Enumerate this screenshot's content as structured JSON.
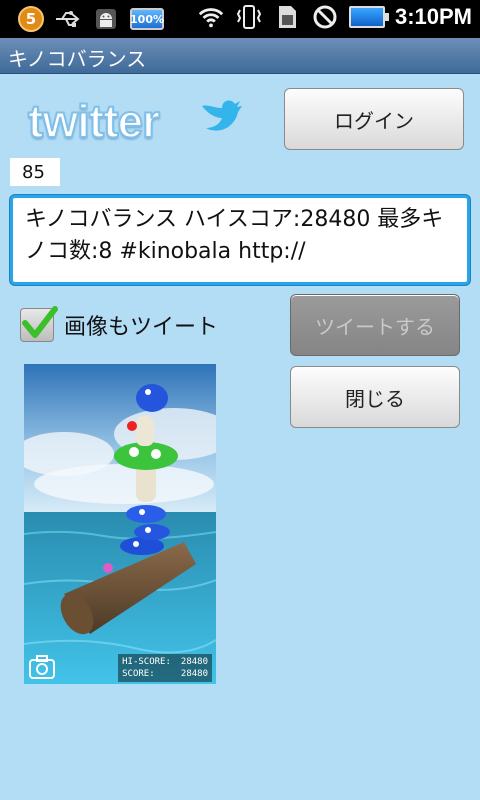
{
  "status_bar": {
    "notification_count": "5",
    "battery_label": "100%",
    "time": "3:10PM"
  },
  "app": {
    "title": "キノコバランス"
  },
  "twitter": {
    "logo_text": "twitter",
    "login_label": "ログイン",
    "char_count": "85",
    "tweet_text": "キノコバランス ハイスコア:28480 最多キノコ数:8 #kinobala http://"
  },
  "attach_image": {
    "label": "画像もツイート",
    "checked": true
  },
  "buttons": {
    "tweet_label": "ツイートする",
    "close_label": "閉じる"
  },
  "game_screenshot": {
    "hiscore_label": "HI-SCORE:",
    "hiscore_value": "28480",
    "score_label": "SCORE:",
    "score_value": "28480"
  },
  "colors": {
    "background": "#b3dcf5",
    "accent": "#2aa4e8",
    "titlebar": "#4f77a4"
  }
}
